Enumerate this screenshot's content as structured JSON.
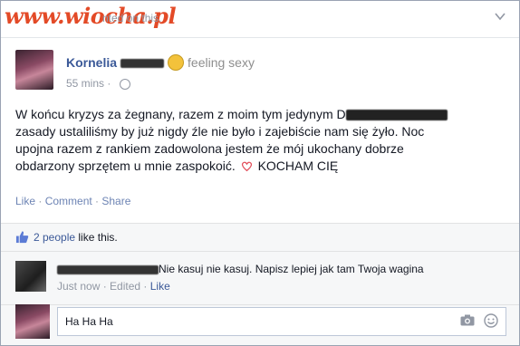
{
  "watermark": "www.wiocha.pl",
  "top": {
    "commented_note": "nted on this."
  },
  "post": {
    "author": "Kornelia",
    "feeling": "feeling sexy",
    "time": "55 mins",
    "text_lines": [
      "W końcu kryzys za żegnany, razem z moim tym jedynym D",
      "zasady ustaliliśmy by już nigdy źle nie było i zajebiście nam się żyło. Noc",
      "upojna razem z rankiem zadowolona jestem że mój ukochany dobrze",
      "obdarzony sprzętem u mnie zaspokoić."
    ],
    "text_end": "KOCHAM CIĘ"
  },
  "actions": {
    "like": "Like",
    "comment": "Comment",
    "share": "Share"
  },
  "likes": {
    "count": "2 people",
    "suffix": "like this."
  },
  "comment": {
    "text": "Nie kasuj nie kasuj. Napisz lepiej jak tam Twoja wagina",
    "time": "Just now",
    "edited": "Edited",
    "like": "Like"
  },
  "composer": {
    "value": "Ha Ha Ha"
  },
  "colors": {
    "link": "#3b5998",
    "muted": "#9197a3",
    "heart": "#e24f5b",
    "watermark": "#e34a27"
  }
}
